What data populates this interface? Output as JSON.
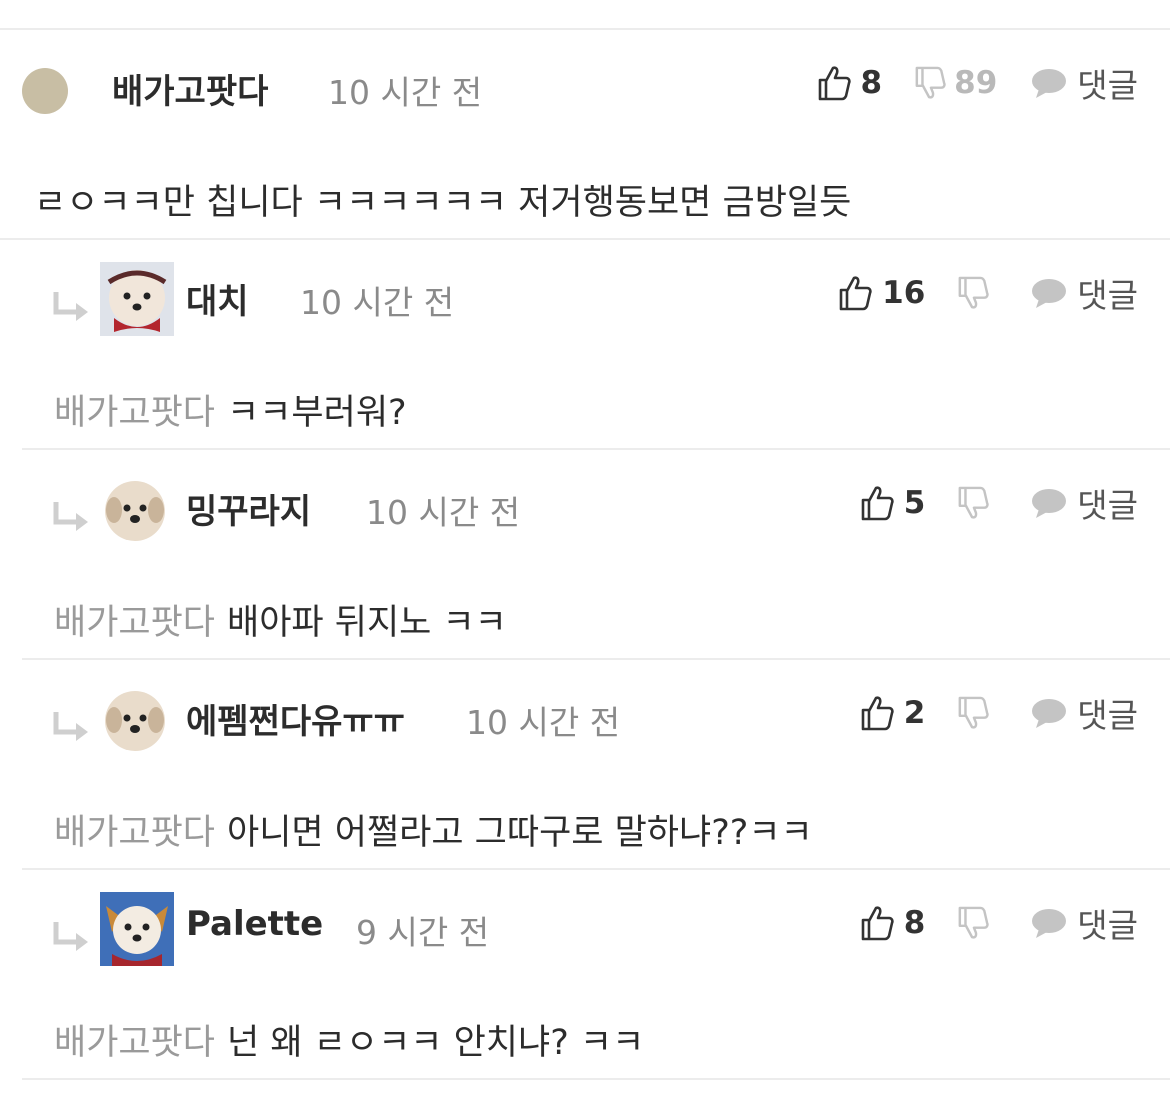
{
  "comments": [
    {
      "nickname": "배가고팟다",
      "time": "10 시간 전",
      "likes": "8",
      "dislikes": "89",
      "reply_label": "댓글",
      "mention": "",
      "text": "ㄹㅇㅋㅋ만 칩니다 ㅋㅋㅋㅋㅋㅋ 저거행동보면 금방일듯",
      "avatar": "tan-circle-avatar"
    },
    {
      "nickname": "대치",
      "time": "10 시간 전",
      "likes": "16",
      "dislikes": "",
      "reply_label": "댓글",
      "mention": "배가고팟다",
      "text": "ㅋㅋ부러워?",
      "avatar": "puppy-red-scarf-avatar"
    },
    {
      "nickname": "밍꾸라지",
      "time": "10 시간 전",
      "likes": "5",
      "dislikes": "",
      "reply_label": "댓글",
      "mention": "배가고팟다",
      "text": "배아파 뒤지노 ㅋㅋ",
      "avatar": "puppy-face-avatar"
    },
    {
      "nickname": "에펨쩐다유ㅠㅠ",
      "time": "10 시간 전",
      "likes": "2",
      "dislikes": "",
      "reply_label": "댓글",
      "mention": "배가고팟다",
      "text": "아니면 어쩔라고 그따구로 말하냐??ㅋㅋ",
      "avatar": "puppy-face-avatar"
    },
    {
      "nickname": "Palette",
      "time": "9 시간 전",
      "likes": "8",
      "dislikes": "",
      "reply_label": "댓글",
      "mention": "배가고팟다",
      "text": "넌 왜 ㄹㅇㅋㅋ 안치냐? ㅋㅋ",
      "avatar": "puppy-blue-background-avatar"
    }
  ],
  "colors": {
    "divider": "#ececec",
    "meta_text": "#8a8a8a",
    "icon_gray": "#c4c4c4",
    "text": "#2c2c2c"
  }
}
